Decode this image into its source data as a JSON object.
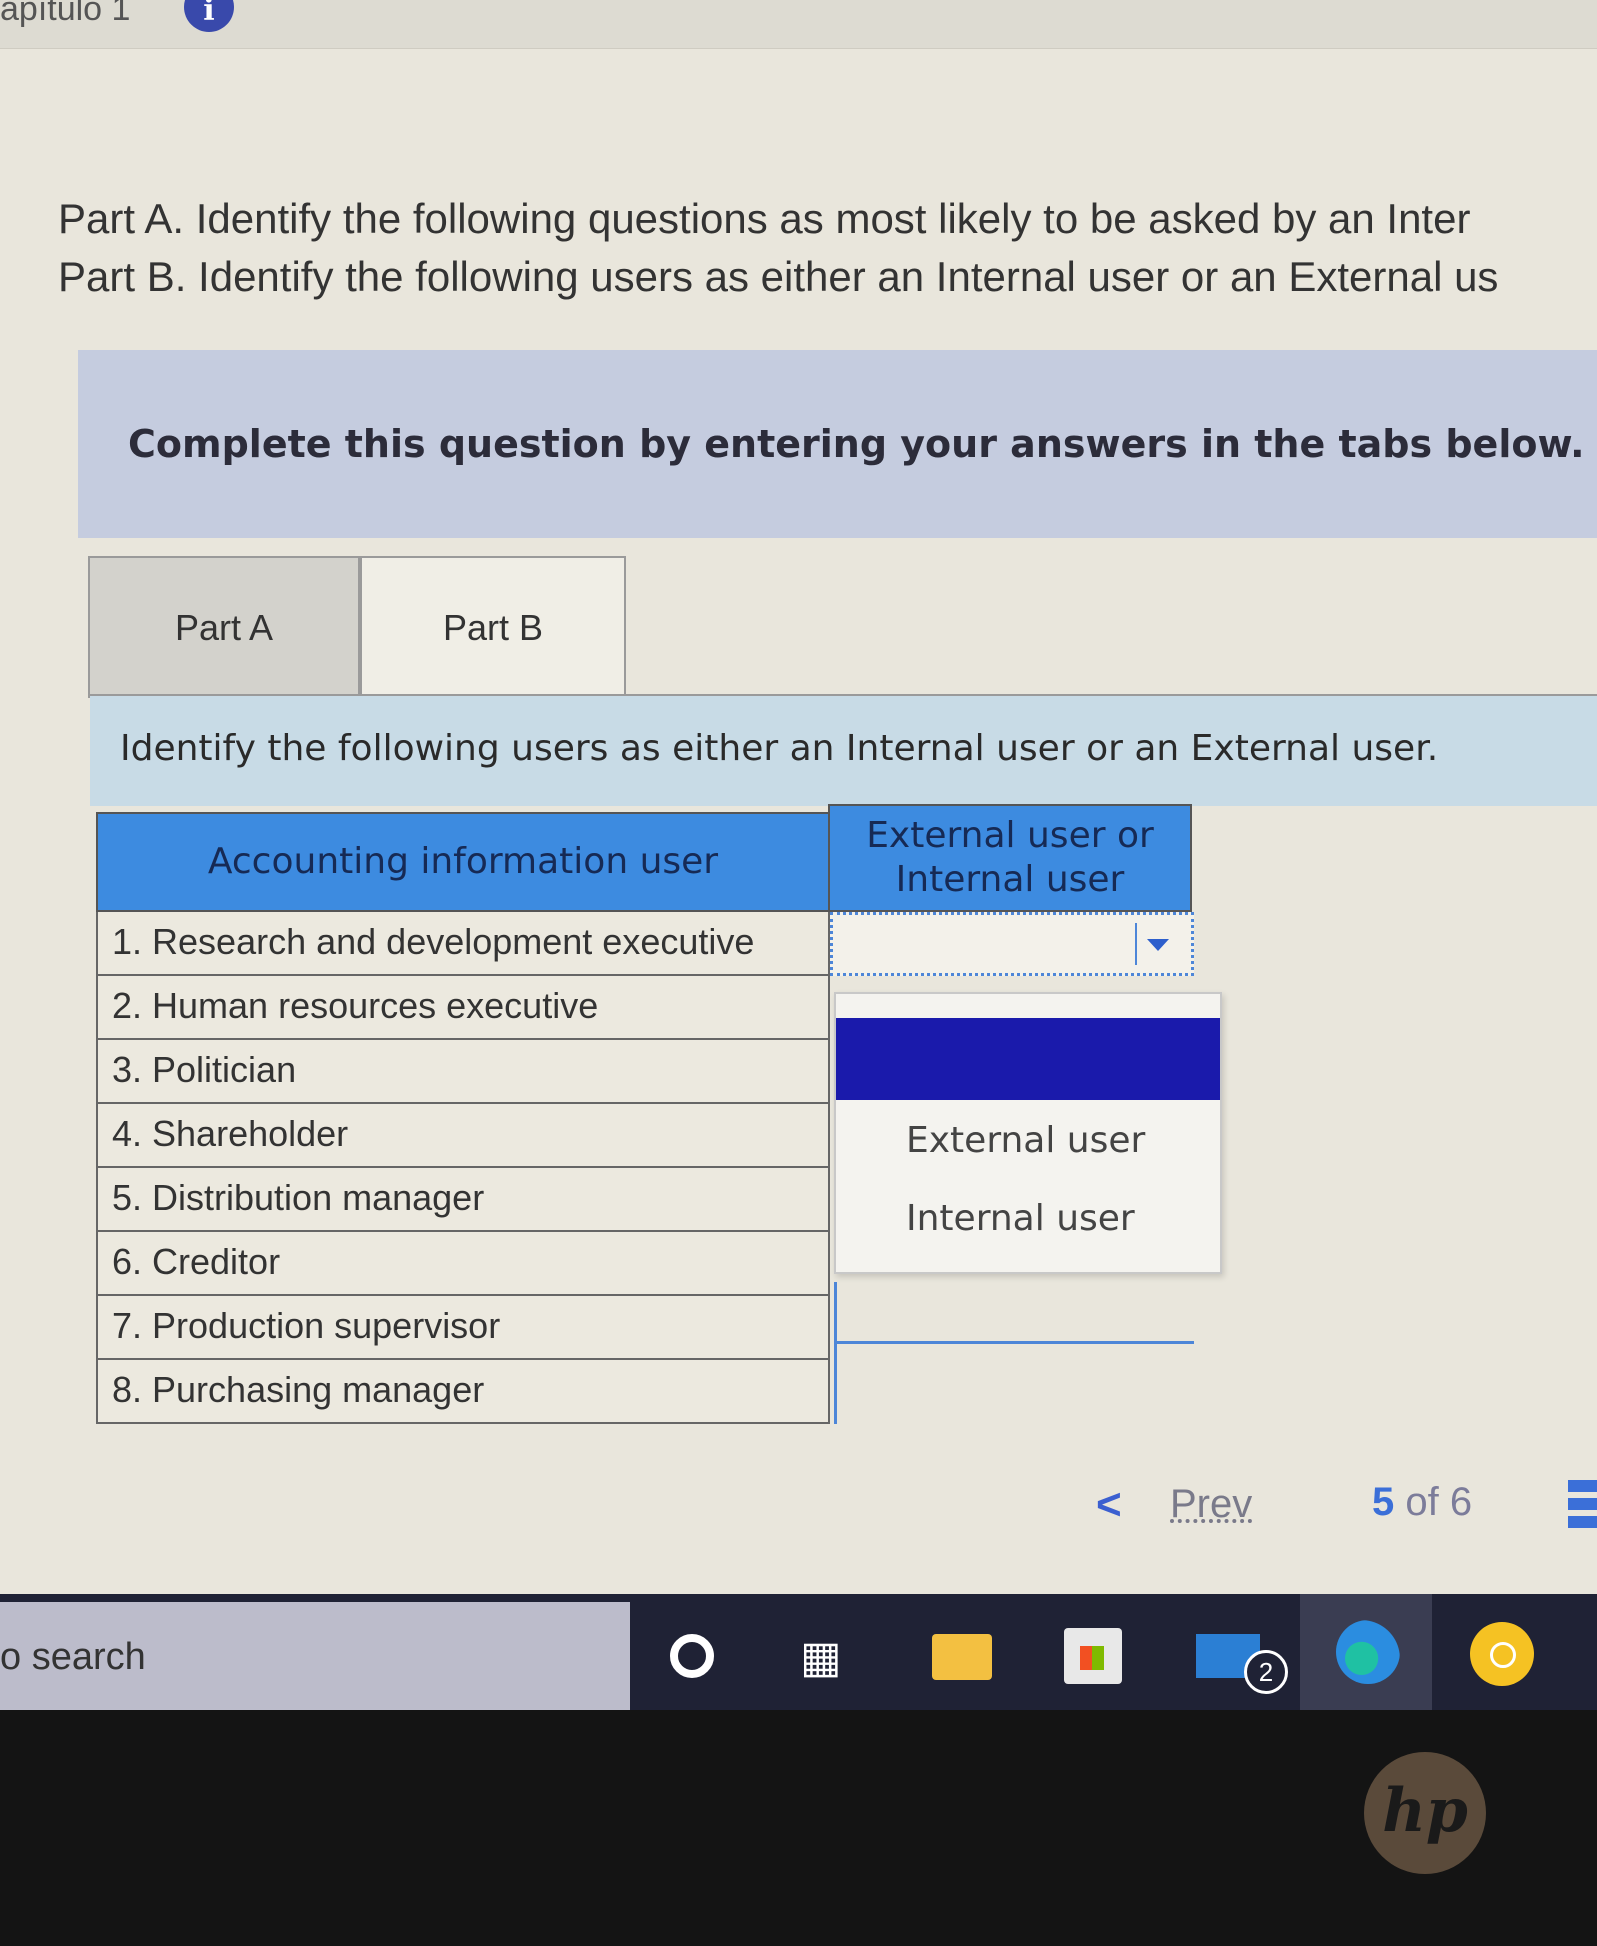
{
  "header": {
    "chapter_fragment": "apítulo 1",
    "info_glyph": "i"
  },
  "instructions": {
    "part_a": "Part A. Identify the following questions as most likely to be asked by an Inter",
    "part_b": "Part B. Identify the following users as either an Internal user or an External us"
  },
  "banner": "Complete this question by entering your answers in the tabs below.",
  "tabs": [
    {
      "label": "Part A"
    },
    {
      "label": "Part B",
      "active": true
    }
  ],
  "subheading": "Identify the following users as either an Internal user or an External user.",
  "table": {
    "headers": [
      "Accounting information user",
      "External user or Internal user"
    ],
    "rows": [
      "1. Research and development executive",
      "2. Human resources executive",
      "3. Politician",
      "4. Shareholder",
      "5. Distribution manager",
      "6. Creditor",
      "7. Production supervisor",
      "8. Purchasing manager"
    ]
  },
  "dropdown": {
    "options": [
      "",
      "External user",
      "Internal user"
    ],
    "highlighted": ""
  },
  "pagination": {
    "prev_label": "Prev",
    "current": "5",
    "of_label": "of",
    "total": "6"
  },
  "taskbar": {
    "search_text": "o search",
    "mail_badge": "2"
  },
  "bezel": {
    "logo": "hp"
  },
  "colors": {
    "header_blue": "#3d8be0",
    "dropdown_highlight": "#1a1aab",
    "link_blue": "#3b6fd8"
  }
}
